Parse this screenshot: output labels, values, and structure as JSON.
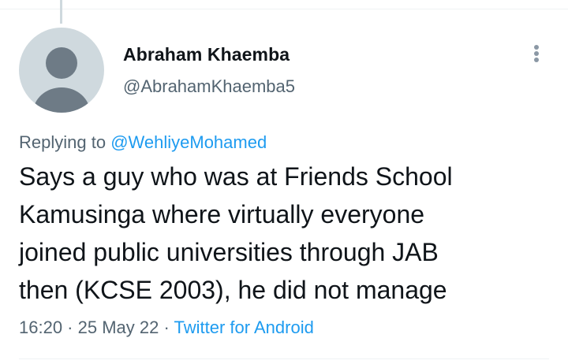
{
  "tweet": {
    "author_name": "Abraham Khaemba",
    "author_handle": "@AbrahamKhaemba5",
    "replying_prefix": "Replying to ",
    "replying_to": "@WehliyeMohamed",
    "text_lines": [
      "Says a guy who was at Friends School",
      "Kamusinga where virtually everyone",
      "joined public universities through JAB",
      "then (KCSE 2003), he did not manage"
    ],
    "time": "16:20",
    "separator": " · ",
    "date": "25 May 22",
    "source": "Twitter for Android"
  },
  "icons": {
    "avatar": "default-profile-icon",
    "more": "more-options-icon"
  },
  "colors": {
    "text_primary": "#0f1419",
    "text_secondary": "#536471",
    "link": "#1d9bf0",
    "avatar_bg": "#cfd9de",
    "avatar_fg": "#6e7b86",
    "divider": "#eff3f4"
  }
}
